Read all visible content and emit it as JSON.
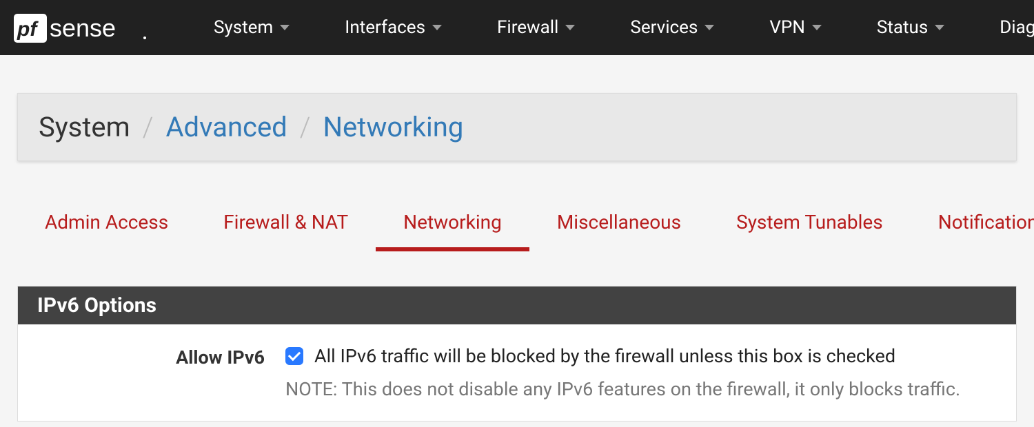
{
  "nav": {
    "items": [
      {
        "label": "System"
      },
      {
        "label": "Interfaces"
      },
      {
        "label": "Firewall"
      },
      {
        "label": "Services"
      },
      {
        "label": "VPN"
      },
      {
        "label": "Status"
      },
      {
        "label": "Diag"
      }
    ]
  },
  "breadcrumb": {
    "root": "System",
    "mid": "Advanced",
    "leaf": "Networking"
  },
  "tabs": [
    {
      "label": "Admin Access",
      "active": false
    },
    {
      "label": "Firewall & NAT",
      "active": false
    },
    {
      "label": "Networking",
      "active": true
    },
    {
      "label": "Miscellaneous",
      "active": false
    },
    {
      "label": "System Tunables",
      "active": false
    },
    {
      "label": "Notification",
      "active": false
    }
  ],
  "panel": {
    "title": "IPv6 Options",
    "row": {
      "label": "Allow IPv6",
      "checked": true,
      "desc": "All IPv6 traffic will be blocked by the firewall unless this box is checked",
      "note": "NOTE: This does not disable any IPv6 features on the firewall, it only blocks traffic."
    }
  }
}
